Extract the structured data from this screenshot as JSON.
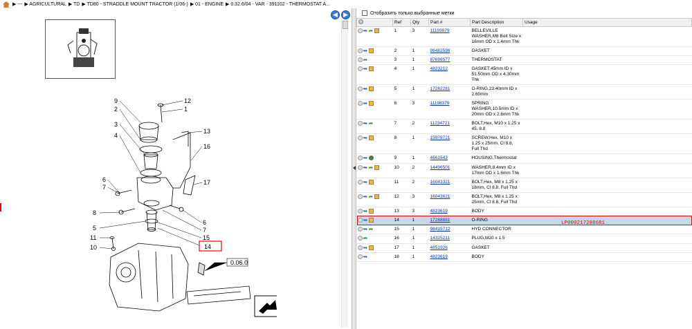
{
  "breadcrumb": {
    "items": [
      "▶ ---",
      "▶ AGRICULTURAL",
      "▶ TD",
      "▶ TD80 - STRADDLE MOUNT TRACTOR (1/06-)",
      "▶ 01 - ENGINE",
      "▶ 0.32.6/04 - VAR - 391102 - THERMOSTAT A..."
    ]
  },
  "diagram": {
    "labels": [
      "9",
      "2",
      "3",
      "4",
      "6",
      "7",
      "8",
      "5",
      "11",
      "10",
      "12",
      "1",
      "13",
      "16",
      "17",
      "6",
      "7",
      "15",
      "14"
    ],
    "section_ref": "0.06.0"
  },
  "filter": {
    "label": "Отобразить только выбранные метки"
  },
  "table": {
    "headers": [
      "Ref",
      "Qty",
      "Part #",
      "Part Description",
      "Usage"
    ],
    "rows": [
      {
        "ref": "1",
        "qty": "3",
        "part": "11193879",
        "desc": "BELLEVILLE WASHER,M8 Bolt Size x 16mm OD x 1.4mm Thk"
      },
      {
        "ref": "2",
        "qty": "1",
        "part": "98482598",
        "desc": "GASKET"
      },
      {
        "ref": "3",
        "qty": "1",
        "part": "87698577",
        "desc": "THERMOSTAT"
      },
      {
        "ref": "4",
        "qty": "1",
        "part": "4823212",
        "desc": "GASKET,45mm ID x 51.50mm OD x 4.30mm Thk"
      },
      {
        "ref": "5",
        "qty": "1",
        "part": "17282281",
        "desc": "O-RING,23.40mm ID x 2.60mm"
      },
      {
        "ref": "6",
        "qty": "3",
        "part": "11198379",
        "desc": "SPRING WASHER,10.5mm ID x 20mm OD x 2.6mm Thk"
      },
      {
        "ref": "7",
        "qty": "2",
        "part": "11234721",
        "desc": "BOLT,Hex, M10 x 1.25 x 45, 8.8"
      },
      {
        "ref": "8",
        "qty": "1",
        "part": "15978721",
        "desc": "SCREW,Hex, M10 x 1.25 x 25mm, Cl 8.8, Full Thd"
      },
      {
        "ref": "9",
        "qty": "1",
        "part": "4661543",
        "desc": "HOUSING,Thermostat"
      },
      {
        "ref": "10",
        "qty": "2",
        "part": "14496501",
        "desc": "WASHER,8.4mm ID x 17mm OD x 1.6mm Thk"
      },
      {
        "ref": "11",
        "qty": "2",
        "part": "16043321",
        "desc": "BOLT,Hex, M8 x 1.25 x 18mm, Cl 8.8, Full Thd"
      },
      {
        "ref": "12",
        "qty": "3",
        "part": "16043621",
        "desc": "BOLT,Hex, M8 x 1.25 x 25mm, Cl 8.8, Full Thd"
      },
      {
        "ref": "13",
        "qty": "3",
        "part": "4823619",
        "desc": "BODY"
      },
      {
        "ref": "14",
        "qty": "1",
        "part": "17288881",
        "desc": "O-RING"
      },
      {
        "ref": "15",
        "qty": "1",
        "part": "98415712",
        "desc": "HYD CONNECTOR"
      },
      {
        "ref": "16",
        "qty": "1",
        "part": "14325211",
        "desc": "PLUG,M20 x 1.5"
      },
      {
        "ref": "17",
        "qty": "1",
        "part": "4851926",
        "desc": "GASKET"
      },
      {
        "ref": "18",
        "qty": "1",
        "part": "4823619",
        "desc": "BODY"
      }
    ],
    "selected_ref": "14"
  },
  "note": "LP000217288681",
  "colors": {
    "highlight": "#ee0000",
    "selected_row": "#c9d6e6",
    "link": "#0033cc"
  }
}
